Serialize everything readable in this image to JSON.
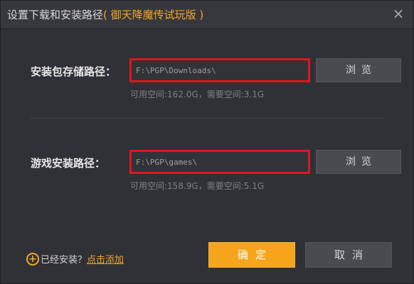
{
  "window": {
    "title_prefix": "设置下载和安装路径",
    "title_game": "( 御天降魔传试玩版 )",
    "close_glyph": "×"
  },
  "download": {
    "label": "安装包存储路径：",
    "path": "F:\\PGP\\Downloads\\",
    "browse_label": "浏览",
    "space_info": "可用空间:162.0G，需要空间:3.1G"
  },
  "install": {
    "label": "游戏安装路径：",
    "path": "F:\\PGP\\games\\",
    "browse_label": "浏览",
    "space_info": "可用空间:158.9G，需要空间:5.1G"
  },
  "footer": {
    "plus_glyph": "+",
    "installed_text": "已经安装？",
    "add_link": "点击添加",
    "confirm_label": "确定",
    "cancel_label": "取消"
  },
  "icons": {
    "close": "close-icon",
    "plus": "plus-circle-icon"
  },
  "colors": {
    "accent": "#f5a623",
    "highlight_border": "#e0141e",
    "background": "#303136"
  }
}
